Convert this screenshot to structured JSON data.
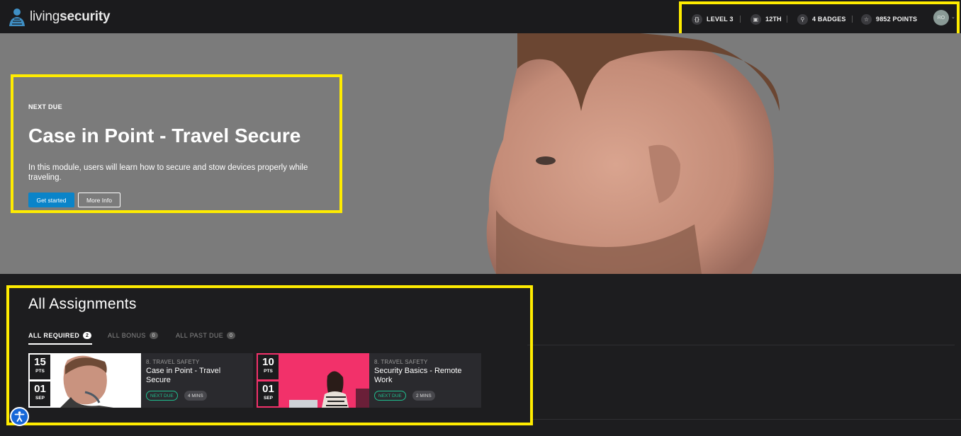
{
  "brand": {
    "logo_light": "living",
    "logo_bold": "security"
  },
  "stats": {
    "level": "LEVEL 3",
    "rank": "12TH",
    "badges": "4 BADGES",
    "points": "9852 POINTS",
    "avatar_initials": "RO"
  },
  "hero": {
    "eyebrow": "NEXT DUE",
    "title": "Case in Point - Travel Secure",
    "description": "In this module, users will learn how to secure and stow devices properly while traveling.",
    "primary_button": "Get started",
    "secondary_button": "More Info"
  },
  "assignments": {
    "title": "All Assignments",
    "tabs": [
      {
        "label": "ALL REQUIRED",
        "count": "2"
      },
      {
        "label": "ALL BONUS",
        "count": "0"
      },
      {
        "label": "ALL PAST DUE",
        "count": "0"
      }
    ],
    "cards": [
      {
        "points": "15",
        "points_label": "PTS",
        "day": "01",
        "month": "SEP",
        "category": "8. TRAVEL SAFETY",
        "title": "Case in Point - Travel Secure",
        "status": "NEXT DUE",
        "duration": "4 MINS"
      },
      {
        "points": "10",
        "points_label": "PTS",
        "day": "01",
        "month": "SEP",
        "category": "8. TRAVEL SAFETY",
        "title": "Security Basics - Remote Work",
        "status": "NEXT DUE",
        "duration": "2 MINS"
      }
    ]
  },
  "colors": {
    "highlight": "#ffec00",
    "primary": "#0a84c9",
    "success": "#1fbf8f",
    "card_pink": "#f2316a"
  }
}
